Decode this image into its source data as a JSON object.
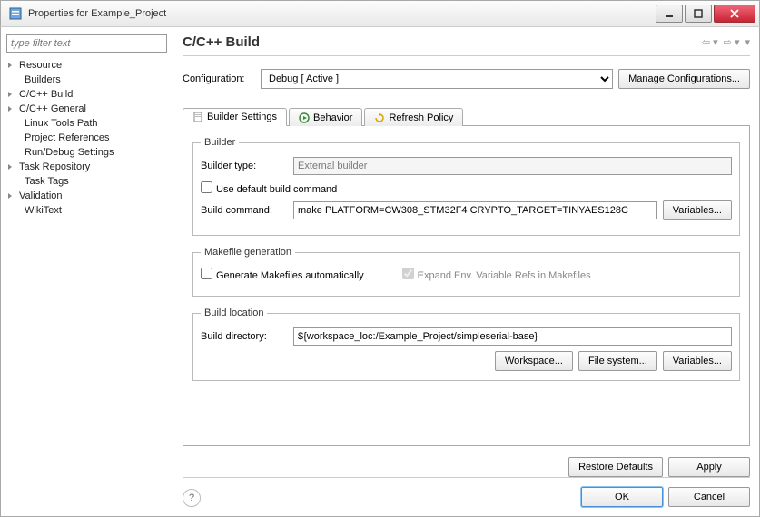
{
  "window": {
    "title": "Properties for Example_Project"
  },
  "filter": {
    "placeholder": "type filter text"
  },
  "tree": {
    "items": [
      {
        "label": "Resource",
        "leaf": false
      },
      {
        "label": "Builders",
        "leaf": true
      },
      {
        "label": "C/C++ Build",
        "leaf": false
      },
      {
        "label": "C/C++ General",
        "leaf": false
      },
      {
        "label": "Linux Tools Path",
        "leaf": true
      },
      {
        "label": "Project References",
        "leaf": true
      },
      {
        "label": "Run/Debug Settings",
        "leaf": true
      },
      {
        "label": "Task Repository",
        "leaf": false
      },
      {
        "label": "Task Tags",
        "leaf": true
      },
      {
        "label": "Validation",
        "leaf": false
      },
      {
        "label": "WikiText",
        "leaf": true
      }
    ]
  },
  "page": {
    "title": "C/C++ Build"
  },
  "config": {
    "label": "Configuration:",
    "value": "Debug  [ Active ]",
    "manage": "Manage Configurations..."
  },
  "tabs": {
    "t0": "Builder Settings",
    "t1": "Behavior",
    "t2": "Refresh Policy"
  },
  "builder": {
    "legend": "Builder",
    "type_label": "Builder type:",
    "type_value": "External builder",
    "use_default": "Use default build command",
    "cmd_label": "Build command:",
    "cmd_value": "make PLATFORM=CW308_STM32F4 CRYPTO_TARGET=TINYAES128C",
    "variables": "Variables..."
  },
  "makefile": {
    "legend": "Makefile generation",
    "gen_auto": "Generate Makefiles automatically",
    "expand_env": "Expand Env. Variable Refs in Makefiles"
  },
  "buildloc": {
    "legend": "Build location",
    "dir_label": "Build directory:",
    "dir_value": "${workspace_loc:/Example_Project/simpleserial-base}",
    "workspace": "Workspace...",
    "filesystem": "File system...",
    "variables": "Variables..."
  },
  "footer": {
    "restore": "Restore Defaults",
    "apply": "Apply",
    "ok": "OK",
    "cancel": "Cancel"
  }
}
